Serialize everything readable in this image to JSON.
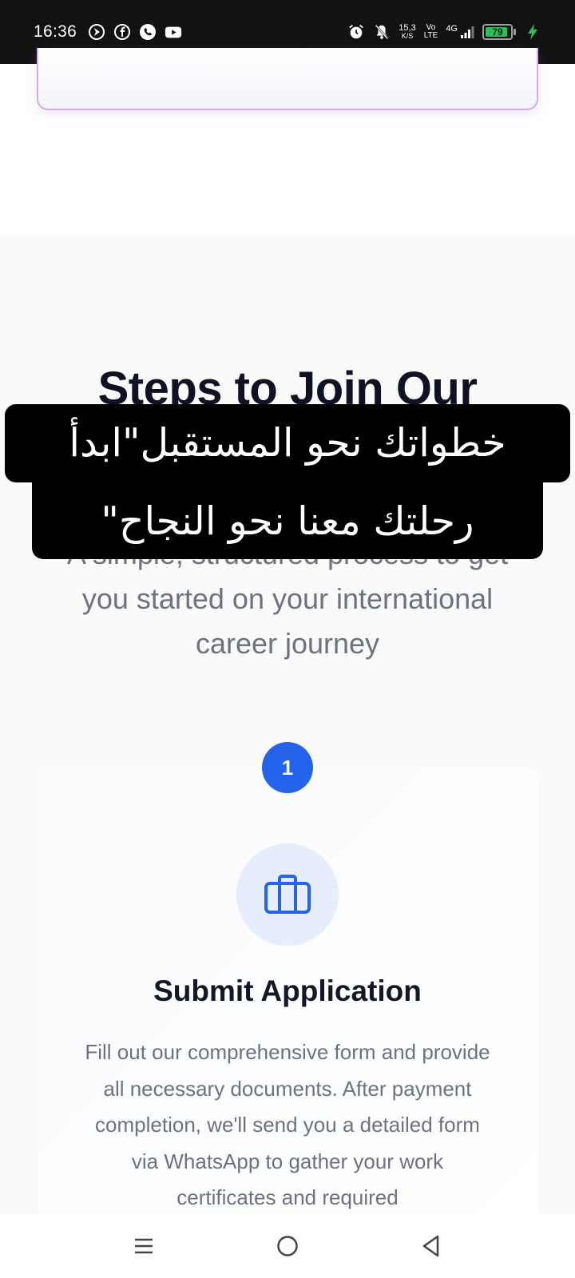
{
  "status_bar": {
    "time": "16:36",
    "net_speed_value": "15,3",
    "net_speed_unit": "K/S",
    "volte_top": "Vo",
    "volte_bottom": "LTE",
    "network": "4G",
    "battery": "79",
    "left_icons": [
      "navigation-icon",
      "facebook-icon",
      "viber-icon",
      "youtube-icon"
    ],
    "right_icons": [
      "alarm-icon",
      "mute-icon",
      "signal-icon",
      "battery-icon",
      "charging-icon"
    ]
  },
  "section": {
    "title": "Steps to Join Our",
    "subtitle_line_partial": "A simple, structured process to get",
    "subtitle": "you started on your international career journey"
  },
  "caption": {
    "line1": "خطواتك نحو المستقبل\"ابدأ",
    "line2": "رحلتك معنا نحو النجاح\""
  },
  "step": {
    "number": "1",
    "icon": "briefcase-icon",
    "title": "Submit Application",
    "description": "Fill out our comprehensive form and provide all necessary documents. After payment completion, we'll send you a detailed form via WhatsApp to gather your work certificates and required"
  },
  "nav": {
    "buttons": [
      "menu-icon",
      "home-icon",
      "back-icon"
    ]
  },
  "colors": {
    "accent": "#2563eb",
    "icon_bg": "#e6eefc",
    "title": "#0f1222",
    "muted": "#6b7280",
    "card_border": "#d7a8ee",
    "battery_green": "#2ebd59"
  }
}
